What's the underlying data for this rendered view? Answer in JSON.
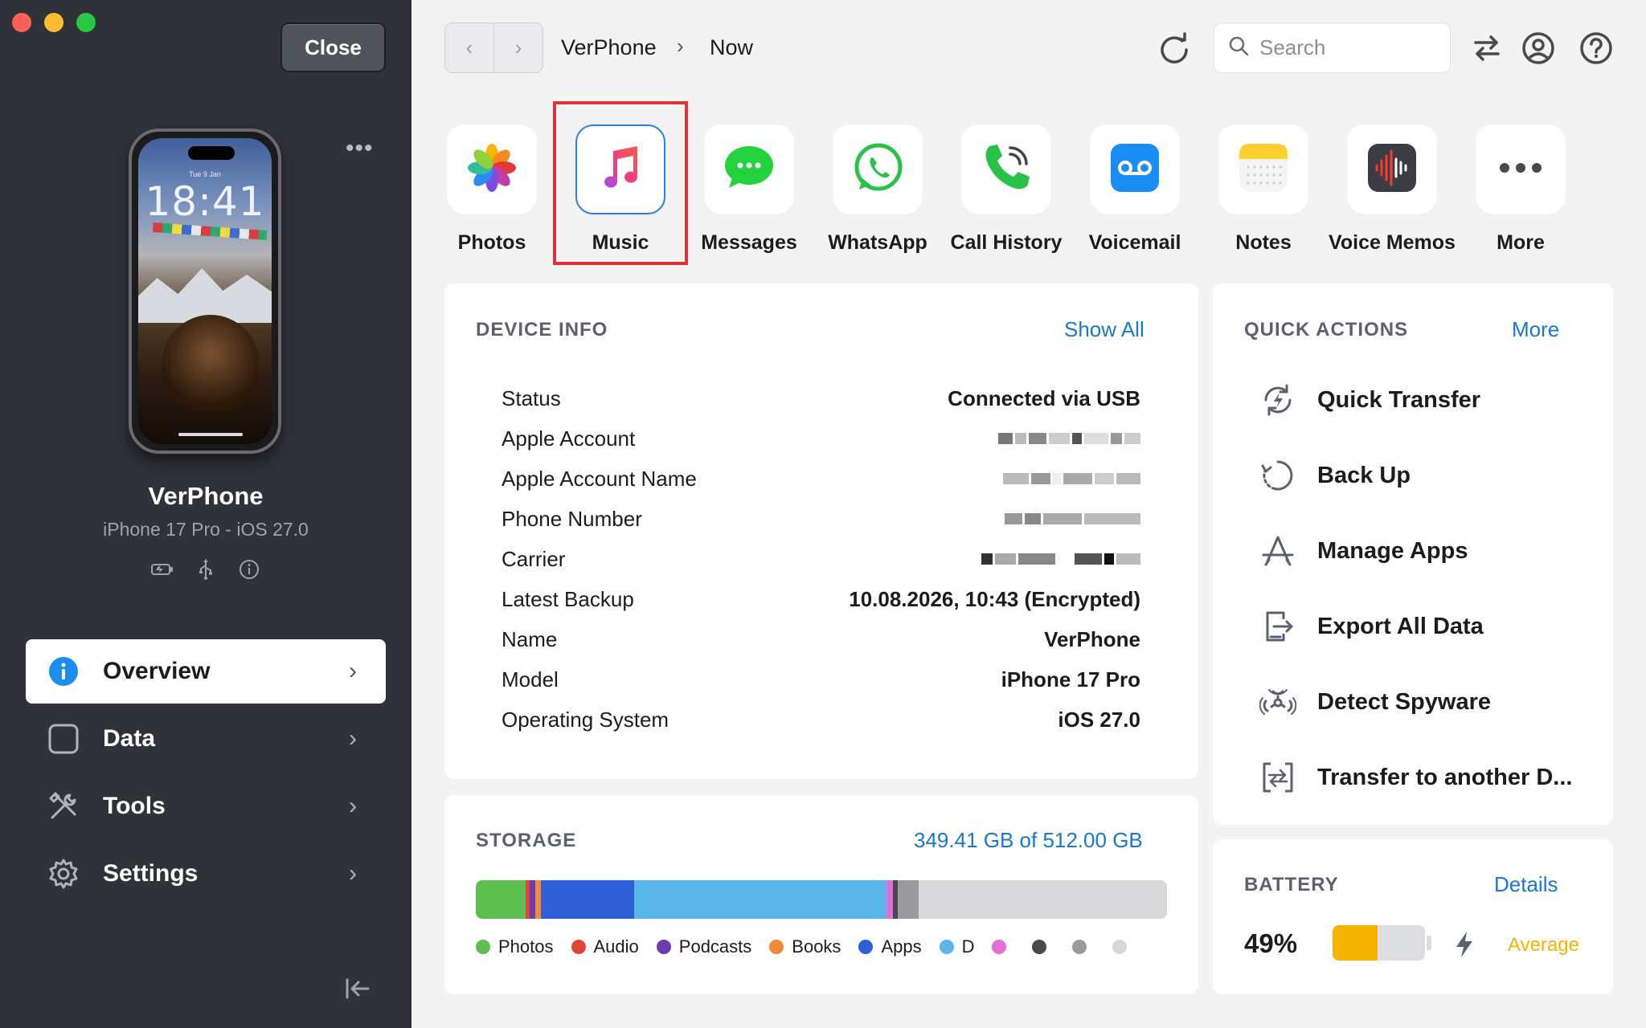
{
  "sidebar": {
    "close_label": "Close",
    "phone": {
      "date": "Tue 9 Jan",
      "time": "18:41"
    },
    "more_glyph": "•••",
    "device_name": "VerPhone",
    "device_model": "iPhone 17 Pro - iOS 27.0",
    "nav": [
      {
        "label": "Overview",
        "icon": "info-icon",
        "active": true
      },
      {
        "label": "Data",
        "icon": "square-icon",
        "active": false
      },
      {
        "label": "Tools",
        "icon": "tools-icon",
        "active": false
      },
      {
        "label": "Settings",
        "icon": "gear-icon",
        "active": false
      }
    ]
  },
  "toolbar": {
    "breadcrumb": [
      "VerPhone",
      "Now"
    ],
    "search_placeholder": "Search"
  },
  "apps": [
    {
      "label": "Photos",
      "icon": "photos-icon"
    },
    {
      "label": "Music",
      "icon": "music-icon"
    },
    {
      "label": "Messages",
      "icon": "messages-icon"
    },
    {
      "label": "WhatsApp",
      "icon": "whatsapp-icon"
    },
    {
      "label": "Call History",
      "icon": "phone-icon"
    },
    {
      "label": "Voicemail",
      "icon": "voicemail-icon"
    },
    {
      "label": "Notes",
      "icon": "notes-icon"
    },
    {
      "label": "Voice Memos",
      "icon": "voice-memos-icon"
    },
    {
      "label": "More",
      "icon": "more-icon"
    }
  ],
  "device_info": {
    "title": "DEVICE INFO",
    "link": "Show All",
    "rows": [
      {
        "label": "Status",
        "value": "Connected via USB"
      },
      {
        "label": "Apple Account",
        "value": ""
      },
      {
        "label": "Apple Account Name",
        "value": ""
      },
      {
        "label": "Phone Number",
        "value": ""
      },
      {
        "label": "Carrier",
        "value": ""
      },
      {
        "label": "Latest Backup",
        "value": "10.08.2026, 10:43 (Encrypted)"
      },
      {
        "label": "Name",
        "value": "VerPhone"
      },
      {
        "label": "Model",
        "value": "iPhone 17 Pro"
      },
      {
        "label": "Operating System",
        "value": "iOS 27.0"
      }
    ]
  },
  "quick_actions": {
    "title": "QUICK ACTIONS",
    "link": "More",
    "items": [
      {
        "label": "Quick Transfer",
        "icon": "quick-transfer-icon"
      },
      {
        "label": "Back Up",
        "icon": "backup-icon"
      },
      {
        "label": "Manage Apps",
        "icon": "app-store-icon"
      },
      {
        "label": "Export All Data",
        "icon": "export-icon"
      },
      {
        "label": "Detect Spyware",
        "icon": "biohazard-icon"
      },
      {
        "label": "Transfer to another D...",
        "icon": "transfer-device-icon"
      }
    ]
  },
  "storage": {
    "title": "STORAGE",
    "usage": "349.41 GB of 512.00 GB",
    "used_gb": 349.41,
    "total_gb": 512.0,
    "segments": [
      {
        "name": "Photos",
        "color": "#5cbf4f",
        "fraction": 0.072
      },
      {
        "name": "Audio",
        "color": "#e0453a",
        "fraction": 0.006
      },
      {
        "name": "Podcasts",
        "color": "#6b3bb0",
        "fraction": 0.008
      },
      {
        "name": "Books",
        "color": "#ee8a38",
        "fraction": 0.008
      },
      {
        "name": "Apps",
        "color": "#2f5fd6",
        "fraction": 0.135
      },
      {
        "name": "D",
        "color": "#5ab5e8",
        "fraction": 0.365
      },
      {
        "name": "",
        "color": "#e46fd8",
        "fraction": 0.009
      },
      {
        "name": "",
        "color": "#4a4a4e",
        "fraction": 0.008
      },
      {
        "name": "",
        "color": "#9b9b9f",
        "fraction": 0.03
      }
    ],
    "legend": [
      {
        "label": "Photos",
        "color": "#5cbf4f"
      },
      {
        "label": "Audio",
        "color": "#e0453a"
      },
      {
        "label": "Podcasts",
        "color": "#6b3bb0"
      },
      {
        "label": "Books",
        "color": "#ee8a38"
      },
      {
        "label": "Apps",
        "color": "#2f5fd6"
      },
      {
        "label": "D",
        "color": "#5ab5e8"
      },
      {
        "label": "",
        "color": "#e46fd8"
      },
      {
        "label": "",
        "color": "#4a4a4e"
      },
      {
        "label": "",
        "color": "#9b9b9f"
      },
      {
        "label": "",
        "color": "#d8d8da"
      }
    ]
  },
  "battery": {
    "title": "BATTERY",
    "link": "Details",
    "percent_label": "49%",
    "level": 0.49,
    "health": "Average",
    "charging_icon": "bolt-icon"
  },
  "colors": {
    "accent": "#1877d4",
    "highlight": "#e0323a",
    "sidebar": "#2f3238",
    "battery_fill": "#f4b400",
    "health": "#f4b400"
  }
}
